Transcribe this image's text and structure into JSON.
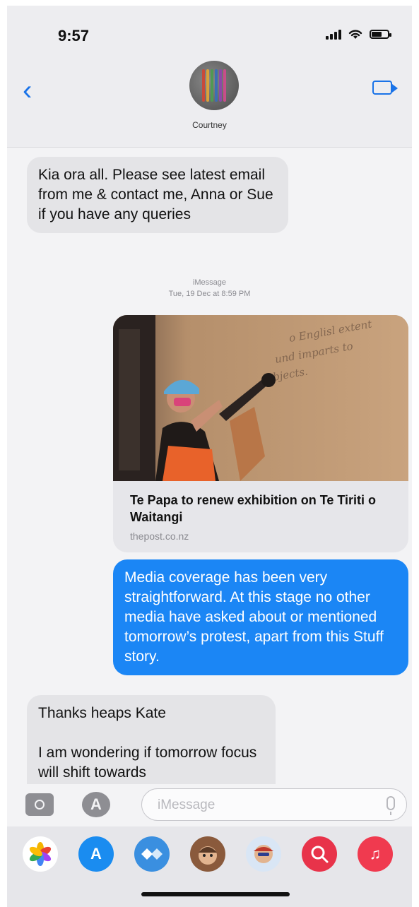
{
  "status": {
    "time": "9:57"
  },
  "header": {
    "contact_name": "Courtney"
  },
  "messages": {
    "m1": "Kia ora all. Please see latest email from me & contact me, Anna or Sue if you have any queries",
    "meta_service": "iMessage",
    "meta_time": "Tue, 19 Dec at 8:59 PM",
    "link_title": "Te Papa to renew exhibition on Te Tiriti o Waitangi",
    "link_domain": "thepost.co.nz",
    "m2": "Media coverage has been very straightforward. At this stage no other media have asked about or mentioned tomorrow’s protest, apart from this Stuff story.",
    "m3_line1": "Thanks heaps Kate",
    "m3_line2": "I am wondering if tomorrow focus will shift towards"
  },
  "input": {
    "placeholder": "iMessage"
  },
  "colors": {
    "accent": "#1a73e8",
    "outgoing_bubble": "#1b86f5",
    "incoming_bubble": "#e4e4e7"
  },
  "drawer": {
    "apps": [
      "photos-icon",
      "app-store-icon",
      "digital-touch-icon",
      "memoji-icon",
      "memoji-stickers-icon",
      "image-search-icon",
      "music-icon"
    ]
  }
}
